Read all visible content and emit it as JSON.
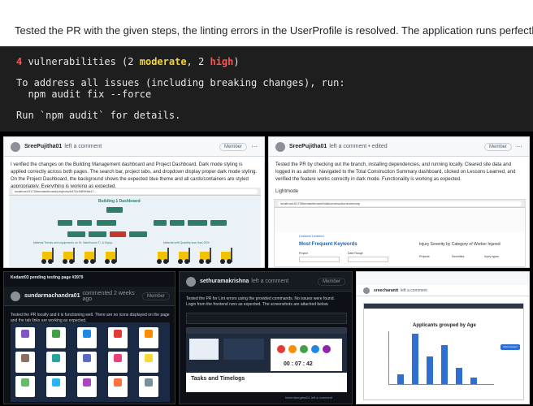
{
  "top": {
    "comment": "Tested the PR with the given steps, the linting errors in the UserProfile is resolved. The application runs perfectly.",
    "terminal": {
      "vuln_count": "4",
      "vuln_mid": " vulnerabilities (",
      "moderate_num": "2",
      "moderate_word": "moderate",
      "sep": ", ",
      "high_num": "2",
      "high_word": "high",
      "close": ")",
      "line2": "To address all issues (including breaking changes), run:",
      "line3": "  npm audit fix --force",
      "line4": "Run `npm audit` for details."
    }
  },
  "panel1": {
    "user": "SreePujitha01",
    "action": "left a comment",
    "badge": "Member",
    "body": "I verified the changes on the Building Management dashboard and Project Dashboard. Dark mode styling is applied correctly across both pages. The search bar, project tabs, and dropdown display proper dark mode styling. On the Project Dashboard, the background shows the expected blue theme and all cards/containers are styled appropriately. Everything is working as expected.",
    "url": "localhost:5173/bmdashboard/projects/6474e3df9f4fa17...",
    "dash_title": "Building 1 Dashboard",
    "caption_left": "Material Trends and equipments on Sr. Warehouse Tr. & Equip.",
    "caption_right": "Material with Quantity less than 20%"
  },
  "panel2": {
    "user": "SreePujitha01",
    "action": "left a comment • edited",
    "badge": "Member",
    "body": "Tested the PR by checking out the branch, installing dependencies, and running locally. Cleared site data and logged in as admin. Navigated to the Total Construction Summary dashboard, clicked on Lessons Learned, and verified the feature works correctly in dark mode. Functionality is working as expected.",
    "mode": "Lightmode",
    "url": "localhost:5173/bmdashboard/totalconstructionsummary",
    "lessons": "Lessons Learned",
    "keywords_title": "Most Frequent Keywords",
    "severity_title": "Injury Severity by Category of Worker Injured",
    "project_label": "Project",
    "date_label": "Date Range",
    "projects_col": "Projects",
    "severities_col": "Severities",
    "injury_col": "Injury types"
  },
  "panel3": {
    "title": "Kedant03 pending testing page #3979",
    "user": "sundarmachandra01",
    "action": "commented 2 weeks ago",
    "badge": "Member",
    "body": "Tested the PR locally and it is functioning well. There are no icons displayed on the page and the tab links are working as expected."
  },
  "panel4": {
    "user": "sethuramakrishna",
    "action": "left a comment",
    "badge": "Member",
    "body": "Tested the PR for Lint errors using the provided commands. No issues were found. Login from the frontend runs as expected. The screenshots are attached below.",
    "section": "Tasks and Timelogs",
    "timer": "00 : 07 : 42",
    "foot": "heisenbergtest01 left a comment"
  },
  "panel5": {
    "user": "sreecharantt",
    "action": "left a comment",
    "chart_title": "Applicants grouped by Age",
    "button": "Add reviewer"
  }
}
